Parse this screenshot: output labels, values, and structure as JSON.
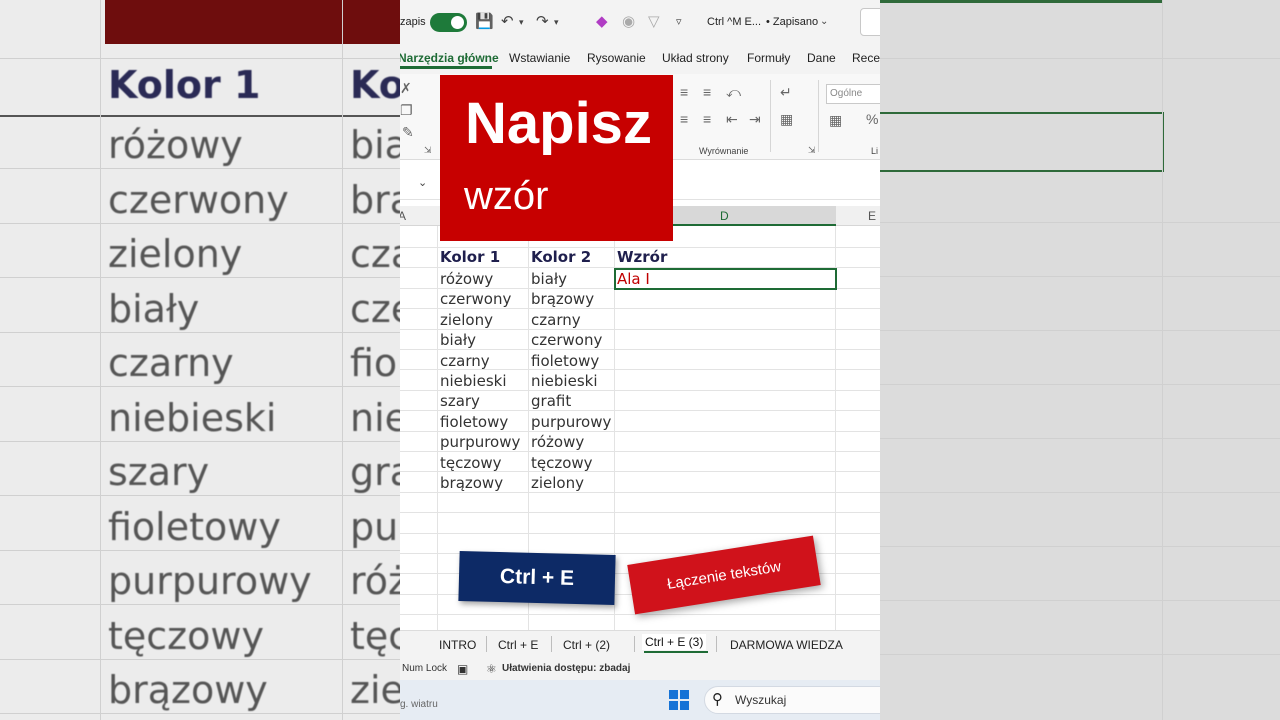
{
  "colors": {
    "excel_green": "#1e6b35",
    "title_red": "#c70000",
    "sticker_blue": "#0d2a66",
    "sticker_red": "#d0121b"
  },
  "titlebar": {
    "autosave_label": "zapis",
    "doc_name": "Ctrl ^M E...",
    "save_status": "• Zapisano",
    "icons": [
      "save-icon",
      "undo-icon",
      "redo-icon",
      "eraser-icon",
      "record-icon",
      "filter-icon",
      "more-icon"
    ]
  },
  "ribbon": {
    "tabs": [
      "Narzędzia główne",
      "Wstawianie",
      "Rysowanie",
      "Układ strony",
      "Formuły",
      "Dane",
      "Recen"
    ],
    "group_alignment": "Wyrównanie",
    "number_format": "Ogólne",
    "group_last": "Li"
  },
  "grid": {
    "col_headers": [
      "A",
      "D",
      "E"
    ],
    "headers": [
      "Kolor 1",
      "Kolor 2",
      "Wzrór"
    ],
    "rows": [
      [
        "różowy",
        "biały"
      ],
      [
        "czerwony",
        "brązowy"
      ],
      [
        "zielony",
        "czarny"
      ],
      [
        "biały",
        "czerwony"
      ],
      [
        "czarny",
        "fioletowy"
      ],
      [
        "niebieski",
        "niebieski"
      ],
      [
        "szary",
        "grafit"
      ],
      [
        "fioletowy",
        "purpurowy"
      ],
      [
        "purpurowy",
        "różowy"
      ],
      [
        "tęczowy",
        "tęczowy"
      ],
      [
        "brązowy",
        "zielony"
      ]
    ],
    "active_cell_text": "Ala I"
  },
  "overlay": {
    "title": "Napisz",
    "subtitle": "wzór",
    "shortcut_sticker": "Ctrl + E",
    "topic_sticker": "Łączenie tekstów"
  },
  "sheets": {
    "tabs": [
      "INTRO",
      "Ctrl + E",
      "Ctrl + (2)",
      "Ctrl + E (3)",
      "DARMOWA WIEDZA"
    ],
    "active_index": 3
  },
  "status": {
    "numlock": "Num Lock",
    "accessibility": "Ułatwienia dostępu: zbadaj"
  },
  "taskbar": {
    "search_placeholder": "Wyszukaj",
    "left_text": "g. wiatru"
  },
  "background": {
    "header_left": "Kolor 1",
    "header_right": "Ko",
    "rows_left": [
      "różowy",
      "czerwony",
      "zielony",
      "biały",
      "czarny",
      "niebieski",
      "szary",
      "fioletowy",
      "purpurowy",
      "tęczowy",
      "brązowy"
    ],
    "rows_right": [
      "bia",
      "bra",
      "cza",
      "cze",
      "fio",
      "nie",
      "gra",
      "pu",
      "róż",
      "tęc",
      "zie"
    ]
  }
}
